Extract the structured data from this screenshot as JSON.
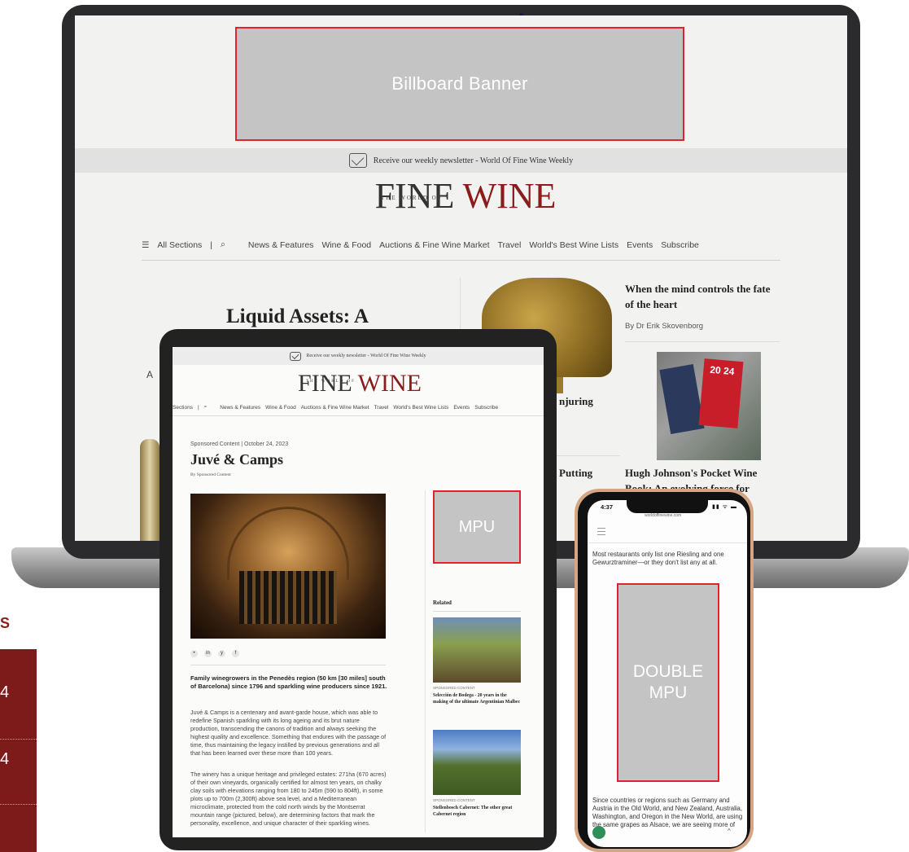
{
  "left": {
    "s_letter": "S",
    "val1": "4",
    "val2": "4"
  },
  "laptop": {
    "billboard": "Billboard Banner",
    "newsletter": "Receive our weekly newsletter - World Of Fine Wine Weekly",
    "logo_small": "THE WORLD OF",
    "logo_fine": "FINE",
    "logo_wine": "WINE",
    "nav": {
      "all_sections": "All Sections",
      "items": [
        "News & Features",
        "Wine & Food",
        "Auctions & Fine Wine Market",
        "Travel",
        "World's Best Wine Lists",
        "Events",
        "Subscribe"
      ]
    },
    "headline": "Liquid Assets: A",
    "intro_letter": "A",
    "conjuring": "njuring",
    "putting": "Putting",
    "mind_title": "When the mind controls the fate of the heart",
    "mind_by": "By Dr Erik Skovenborg",
    "book_year": "20 24",
    "hugh_title": "Hugh Johnson's Pocket Wine Book: An evolving force for"
  },
  "tablet": {
    "newsletter": "Receive our weekly newsletter - World Of Fine Wine Weekly",
    "logo_small": "THE WORLD OF",
    "logo_fine": "FINE",
    "logo_wine": "WINE",
    "nav": {
      "all_sections": "Sections",
      "items": [
        "News & Features",
        "Wine & Food",
        "Auctions & Fine Wine Market",
        "Travel",
        "World's Best Wine Lists",
        "Events",
        "Subscribe"
      ]
    },
    "meta": "Sponsored Content | October 24, 2023",
    "title": "Juvé & Camps",
    "byline": "By Sponsored Content",
    "lead": "Family winegrowers in the Penedès region (50 km [30 miles] south of Barcelona) since 1796 and sparkling wine producers since 1921.",
    "para1": "Juvé & Camps is a centenary and avant-garde house, which was able to redefine Spanish sparkling with its long ageing and its brut nature production, transcending the canons of tradition and always seeking the highest quality and excellence. Something that endures with the passage of time, thus maintaining the legacy instilled by previous generations and all that has been learned over these more than 100 years.",
    "para2": "The winery has a unique heritage and privileged estates: 271ha (670 acres) of their own vineyards, organically certified for almost ten years, on chalky clay soils with elevations ranging from 180 to 245m (590 to 804ft), in some plots up to 700m (2,300ft) above sea level, and a Mediterranean microclimate, protected from the cold north winds by the Montserrat mountain range (pictured, below), are determining factors that mark the personality, excellence, and unique character of their sparkling wines.",
    "mpu": "MPU",
    "related": "Related",
    "sponsored_label": "SPONSORED CONTENT",
    "related1": "Selección de Bodega - 20 years in the making of the ultimate Argentinian Malbec",
    "related2": "Stellenbosch Cabernet: The other great Cabernet region"
  },
  "phone": {
    "time": "4:37",
    "status": "▮▮ ᯤ ▬",
    "url": "worldoffinewine.com",
    "text1": "Most restaurants only list one Riesling and one Gewurztraminer—or they don't list any at all.",
    "double_mpu": "DOUBLE\nMPU",
    "text2": "Since countries or regions such as Germany and Austria in the Old World, and New Zealand, Australia, Washington, and Oregon in the New World, are using the same grapes as Alsace, we are seeing more of"
  }
}
